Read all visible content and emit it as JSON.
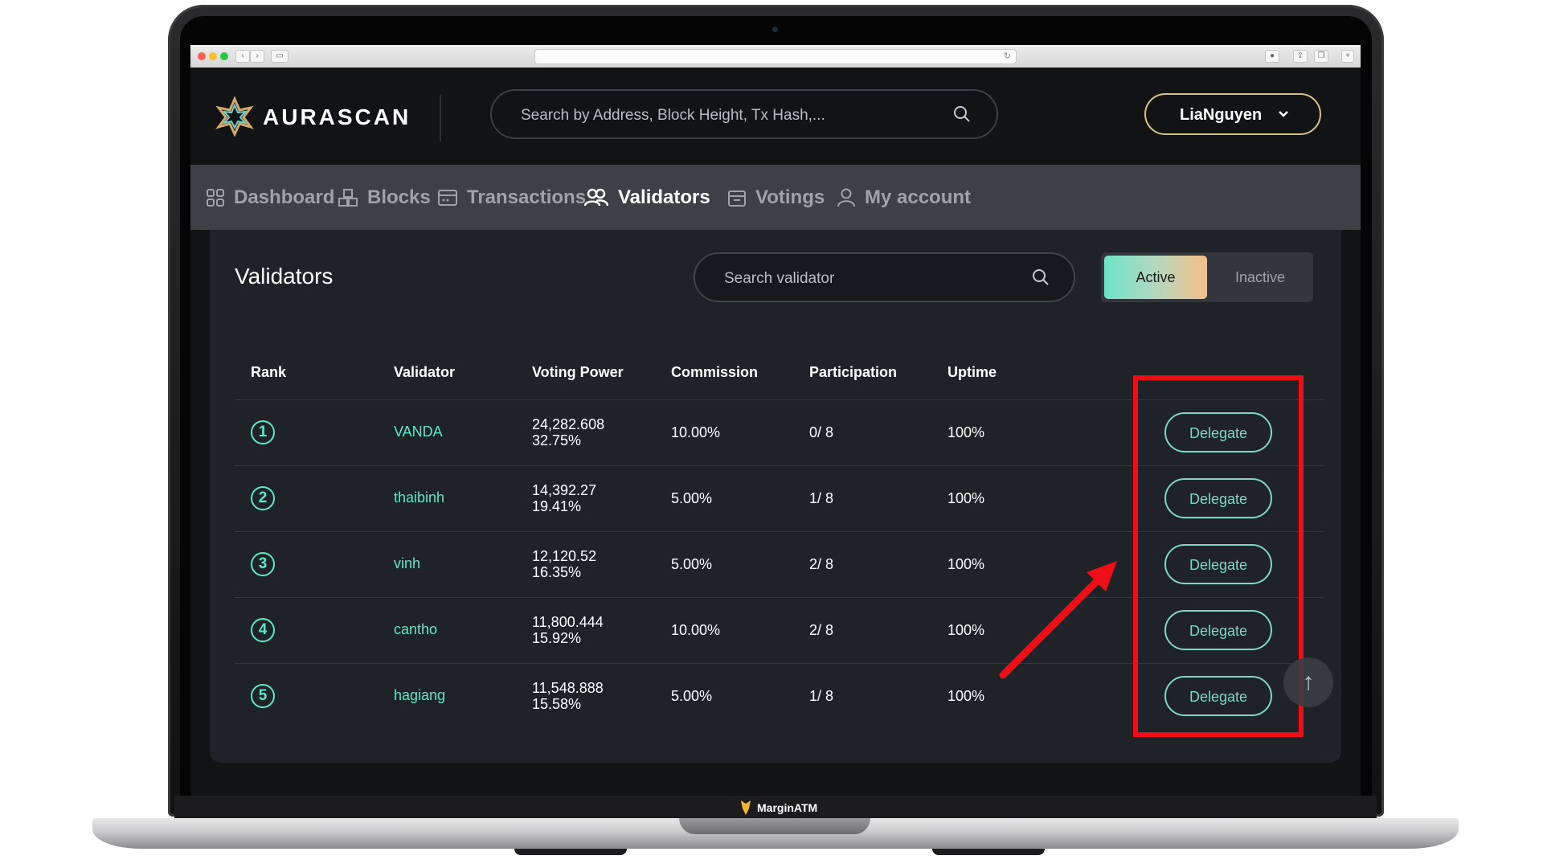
{
  "browser": {},
  "header": {
    "logo_text": "AURASCAN",
    "search_placeholder": "Search by Address, Block Height, Tx Hash,...",
    "account_name": "LiaNguyen"
  },
  "nav": {
    "items": [
      {
        "label": "Dashboard",
        "icon": "dashboard-grid-icon"
      },
      {
        "label": "Blocks",
        "icon": "blocks-icon"
      },
      {
        "label": "Transactions",
        "icon": "transactions-icon"
      },
      {
        "label": "Validators",
        "icon": "users-icon",
        "active": true
      },
      {
        "label": "Votings",
        "icon": "votings-icon"
      },
      {
        "label": "My account",
        "icon": "user-icon"
      }
    ]
  },
  "validators": {
    "title": "Validators",
    "search_placeholder": "Search validator",
    "toggle": {
      "active": "Active",
      "inactive": "Inactive"
    },
    "columns": [
      "Rank",
      "Validator",
      "Voting Power",
      "Commission",
      "Participation",
      "Uptime"
    ],
    "rows": [
      {
        "rank": "1",
        "name": "VANDA",
        "power": "24,282.608",
        "power_pct": "32.75%",
        "commission": "10.00%",
        "participation": "0/ 8",
        "uptime": "100%",
        "action": "Delegate"
      },
      {
        "rank": "2",
        "name": "thaibinh",
        "power": "14,392.27",
        "power_pct": "19.41%",
        "commission": "5.00%",
        "participation": "1/ 8",
        "uptime": "100%",
        "action": "Delegate"
      },
      {
        "rank": "3",
        "name": "vinh",
        "power": "12,120.52",
        "power_pct": "16.35%",
        "commission": "5.00%",
        "participation": "2/ 8",
        "uptime": "100%",
        "action": "Delegate"
      },
      {
        "rank": "4",
        "name": "cantho",
        "power": "11,800.444",
        "power_pct": "15.92%",
        "commission": "10.00%",
        "participation": "2/ 8",
        "uptime": "100%",
        "action": "Delegate"
      },
      {
        "rank": "5",
        "name": "hagiang",
        "power": "11,548.888",
        "power_pct": "15.58%",
        "commission": "5.00%",
        "participation": "1/ 8",
        "uptime": "100%",
        "action": "Delegate"
      }
    ]
  },
  "footer": {
    "brand": "MarginATM"
  },
  "colors": {
    "accent": "#5ee6c8",
    "highlight": "#ee0f16",
    "account_border": "#d8c28c"
  }
}
